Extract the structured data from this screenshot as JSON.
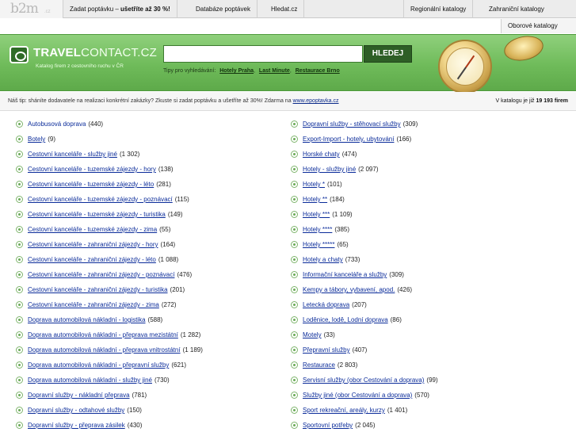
{
  "topnav": {
    "logo_text": "b2m",
    "logo_suffix": ".cz",
    "items": [
      {
        "label": "Zadat poptávku – ",
        "bold": "ušetříte až 30 %!"
      },
      {
        "label": "Databáze poptávek"
      },
      {
        "label": "Hledat.cz"
      },
      {
        "label": "Regionální katalogy"
      },
      {
        "label": "Zahraniční katalogy"
      }
    ],
    "sub_item": "Oborové katalogy"
  },
  "banner": {
    "brand_bold": "TRAVEL",
    "brand_rest": "CONTACT.CZ",
    "tagline": "Katalog firem z cestovního ruchu v ČR",
    "search": {
      "value": "",
      "button": "HLEDEJ"
    },
    "tips_label": "Tipy pro vyhledávání:",
    "tips": [
      "Hotely Praha",
      "Last Minute",
      "Restaurace Brno"
    ]
  },
  "info": {
    "tip_text": "Náš tip: sháníte dodavatele na realizaci konkrétní zakázky? Zkuste si zadat poptávku a ušetříte až 30%! Zdarma na",
    "tip_link": "www.epoptavka.cz",
    "count_text": "V katalogu je již",
    "count_value": "19 193 firem"
  },
  "colors": {
    "banner": "#6fbb5a",
    "link": "#0b2c9a",
    "bullet": "#6aa957"
  },
  "categories_left": [
    {
      "label": "Autobusová doprava",
      "count": "(440)",
      "link": false
    },
    {
      "label": "Botely",
      "count": "(9)"
    },
    {
      "label": "Cestovní kanceláře - služby jiné",
      "count": "(1 302)"
    },
    {
      "label": "Cestovní kanceláře - tuzemské zájezdy - hory",
      "count": "(138)"
    },
    {
      "label": "Cestovní kanceláře - tuzemské zájezdy - léto",
      "count": "(281)"
    },
    {
      "label": "Cestovní kanceláře - tuzemské zájezdy - poznávací",
      "count": "(115)"
    },
    {
      "label": "Cestovní kanceláře - tuzemské zájezdy - turistika",
      "count": "(149)"
    },
    {
      "label": "Cestovní kanceláře - tuzemské zájezdy - zima",
      "count": "(55)"
    },
    {
      "label": "Cestovní kanceláře - zahraniční zájezdy - hory",
      "count": "(164)"
    },
    {
      "label": "Cestovní kanceláře - zahraniční zájezdy - léto",
      "count": "(1 088)"
    },
    {
      "label": "Cestovní kanceláře - zahraniční zájezdy - poznávací",
      "count": "(476)"
    },
    {
      "label": "Cestovní kanceláře - zahraniční zájezdy - turistika",
      "count": "(201)"
    },
    {
      "label": "Cestovní kanceláře - zahraniční zájezdy - zima",
      "count": "(272)"
    },
    {
      "label": "Doprava automobilová nákladní - logistika",
      "count": "(588)"
    },
    {
      "label": "Doprava automobilová nákladní - přeprava mezistátní",
      "count": "(1 282)"
    },
    {
      "label": "Doprava automobilová nákladní - přeprava vnitrostátní",
      "count": "(1 189)"
    },
    {
      "label": "Doprava automobilová nákladní - přepravní služby",
      "count": "(621)"
    },
    {
      "label": "Doprava automobilová nákladní - služby jiné",
      "count": "(730)"
    },
    {
      "label": "Dopravní služby - nákladní přeprava",
      "count": "(781)"
    },
    {
      "label": "Dopravní služby - odtahové služby",
      "count": "(150)"
    },
    {
      "label": "Dopravní služby - přeprava zásilek",
      "count": "(430)"
    }
  ],
  "categories_right": [
    {
      "label": "Dopravní služby - stěhovací služby",
      "count": "(309)"
    },
    {
      "label": "Export-Import - hotely, ubytování",
      "count": "(166)"
    },
    {
      "label": "Horské chaty",
      "count": "(474)"
    },
    {
      "label": "Hotely - služby jiné",
      "count": "(2 097)"
    },
    {
      "label": "Hotely *",
      "count": "(101)"
    },
    {
      "label": "Hotely **",
      "count": "(184)"
    },
    {
      "label": "Hotely ***",
      "count": "(1 109)"
    },
    {
      "label": "Hotely ****",
      "count": "(385)"
    },
    {
      "label": "Hotely *****",
      "count": "(65)"
    },
    {
      "label": "Hotely a chaty",
      "count": "(733)"
    },
    {
      "label": "Informační kanceláře a služby",
      "count": "(309)"
    },
    {
      "label": "Kempy a tábory, vybavení, apod.",
      "count": "(426)"
    },
    {
      "label": "Letecká doprava",
      "count": "(207)"
    },
    {
      "label": "Loděnice, lodě, Lodní doprava",
      "count": "(86)"
    },
    {
      "label": "Motely",
      "count": "(33)"
    },
    {
      "label": "Přepravní služby",
      "count": "(407)"
    },
    {
      "label": "Restaurace",
      "count": "(2 803)"
    },
    {
      "label": "Servisní služby (obor Cestování a doprava)",
      "count": "(99)"
    },
    {
      "label": "Služby jiné (obor Cestování a doprava)",
      "count": "(570)"
    },
    {
      "label": "Sport rekreační, areály, kurzy",
      "count": "(1 401)"
    },
    {
      "label": "Sportovní potřeby",
      "count": "(2 045)"
    }
  ]
}
